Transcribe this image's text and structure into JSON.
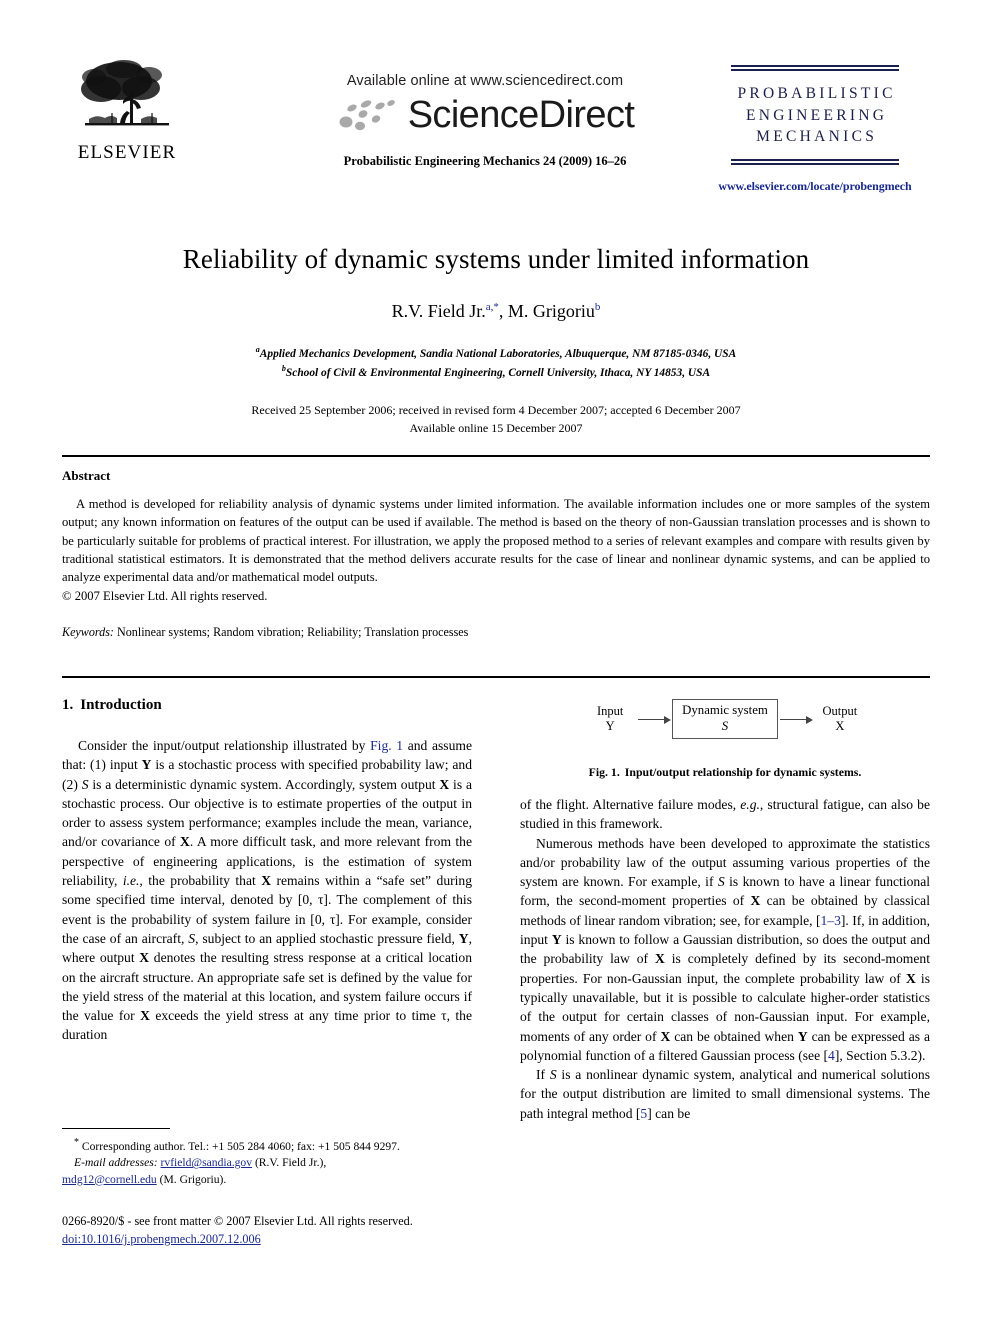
{
  "masthead": {
    "publisher_name": "ELSEVIER",
    "publisher_logo_icon": "elsevier-tree-logo",
    "available_online": "Available online at www.sciencedirect.com",
    "sciencedirect_wordmark": "ScienceDirect",
    "sciencedirect_swoosh_icon": "sciencedirect-swoosh-icon",
    "journal_reference": "Probabilistic Engineering Mechanics 24 (2009) 16–26",
    "journal_masthead_line1": "PROBABILISTIC",
    "journal_masthead_line2": "ENGINEERING",
    "journal_masthead_line3": "MECHANICS",
    "journal_url": "www.elsevier.com/locate/probengmech"
  },
  "title_block": {
    "title": "Reliability of dynamic systems under limited information",
    "author1_name": "R.V. Field Jr.",
    "author1_marks": "a,*",
    "author_separator": ", ",
    "author2_name": "M. Grigoriu",
    "author2_marks": "b",
    "affiliation_a_mark": "a",
    "affiliation_a": "Applied Mechanics Development, Sandia National Laboratories, Albuquerque, NM 87185-0346, USA",
    "affiliation_b_mark": "b",
    "affiliation_b": "School of Civil & Environmental Engineering, Cornell University, Ithaca, NY 14853, USA",
    "received_line": "Received 25 September 2006; received in revised form 4 December 2007; accepted 6 December 2007",
    "available_line": "Available online 15 December 2007"
  },
  "abstract": {
    "heading": "Abstract",
    "body": "A method is developed for reliability analysis of dynamic systems under limited information. The available information includes one or more samples of the system output; any known information on features of the output can be used if available. The method is based on the theory of non-Gaussian translation processes and is shown to be particularly suitable for problems of practical interest. For illustration, we apply the proposed method to a series of relevant examples and compare with results given by traditional statistical estimators. It is demonstrated that the method delivers accurate results for the case of linear and nonlinear dynamic systems, and can be applied to analyze experimental data and/or mathematical model outputs.",
    "copyright": "© 2007 Elsevier Ltd. All rights reserved.",
    "keywords_label": "Keywords:",
    "keywords_value": "Nonlinear systems; Random vibration; Reliability; Translation processes"
  },
  "section": {
    "number": "1.",
    "heading": "Introduction"
  },
  "left_column": {
    "paragraph1_parts": [
      "Consider the input/output relationship illustrated by ",
      "Fig. 1",
      " and assume that: (1) input ",
      "Y",
      " is a stochastic process with specified probability law; and (2) ",
      "S",
      " is a deterministic dynamic system. Accordingly, system output ",
      "X",
      " is a stochastic process. Our objective is to estimate properties of the output in order to assess system performance; examples include the mean, variance, and/or covariance of ",
      "X",
      ". A more difficult task, and more relevant from the perspective of engineering applications, is the estimation of system reliability, ",
      "i.e.",
      ", the probability that ",
      "X",
      " remains within a “safe set” during some specified time interval, denoted by [0, τ]. The complement of this event is the probability of system failure in [0, τ]. For example, consider the case of an aircraft, ",
      "S",
      ", subject to an applied stochastic pressure field, ",
      "Y",
      ", where output ",
      "X",
      " denotes the resulting stress response at a critical location on the aircraft structure. An appropriate safe set is defined by the value for the yield stress of the material at this location, and system failure occurs if the value for ",
      "X",
      " exceeds the yield stress at any time prior to time τ, the duration"
    ]
  },
  "figure": {
    "input_label_line1": "Input",
    "input_label_line2": "Y",
    "box_line1": "Dynamic system",
    "box_line2": "S",
    "output_label_line1": "Output",
    "output_label_line2": "X",
    "caption_number": "Fig. 1.",
    "caption_text": "Input/output relationship for dynamic systems.",
    "arrow_in_icon": "arrow-right-icon",
    "arrow_out_icon": "arrow-right-icon"
  },
  "right_column": {
    "paragraph_cont": "of the flight. Alternative failure modes, e.g., structural fatigue, can also be studied in this framework.",
    "paragraph2_pre": "Numerous methods have been developed to approximate the statistics and/or probability law of the output assuming various properties of the system are known. For example, if ",
    "ref_1_3": "1–3",
    "ref_4": "4",
    "ref_5": "5",
    "paragraph3_pre": "If ",
    "paragraph3_post": " is a nonlinear dynamic system, analytical and numerical solutions for the output distribution are limited to small dimensional systems. The path integral method ",
    "paragraph3_tail": " can be"
  },
  "footnotes": {
    "corresponding_star": "*",
    "corresponding": "Corresponding author. Tel.: +1 505 284 4060; fax: +1 505 844 9297.",
    "email_label": "E-mail addresses:",
    "email1": "rvfield@sandia.gov",
    "email1_owner": "(R.V. Field Jr.),",
    "email2": "mdg12@cornell.edu",
    "email2_owner": "(M. Grigoriu).",
    "issn_line": "0266-8920/$ - see front matter © 2007 Elsevier Ltd. All rights reserved.",
    "doi_line": "doi:10.1016/j.probengmech.2007.12.006"
  },
  "colors": {
    "link": "#1a2a8a",
    "masthead_navy": "#1b1f4b",
    "text": "#000000"
  }
}
